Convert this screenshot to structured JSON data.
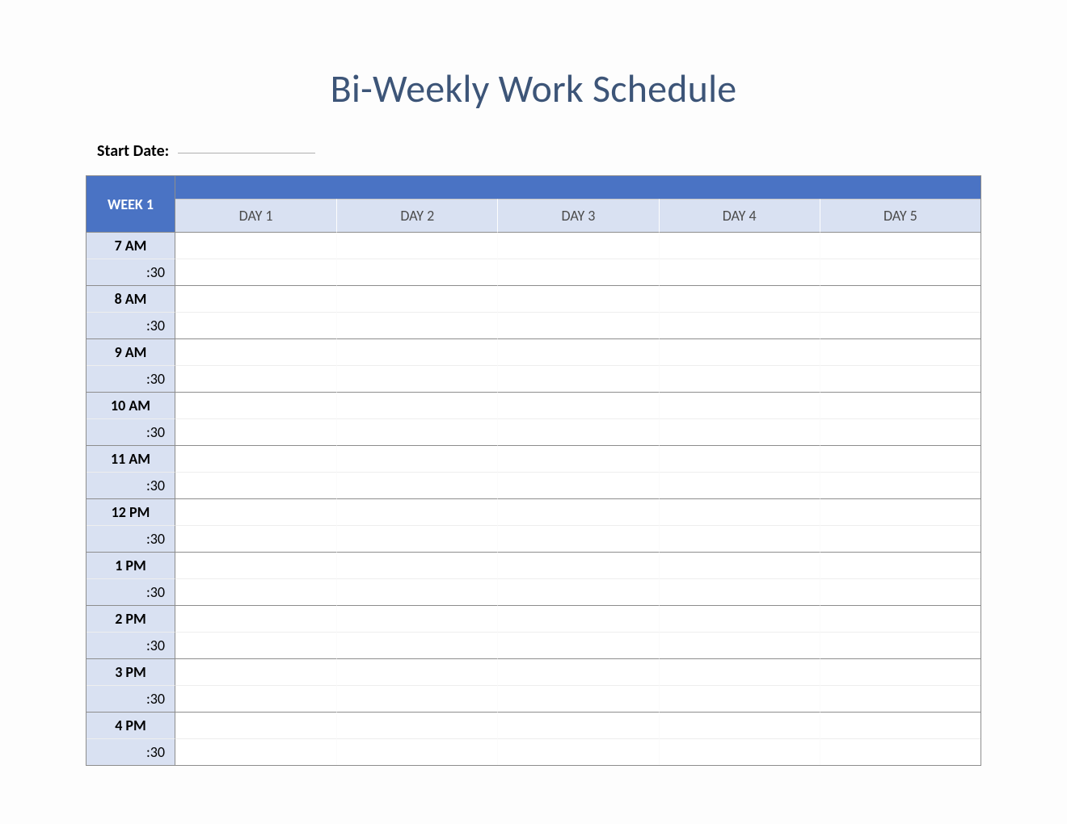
{
  "title": "Bi-Weekly Work Schedule",
  "start_date_label": "Start Date:",
  "start_date_value": "",
  "week_label": "WEEK 1",
  "days": [
    "DAY 1",
    "DAY 2",
    "DAY 3",
    "DAY 4",
    "DAY 5"
  ],
  "half_label": ":30",
  "hours": [
    "7 AM",
    "8 AM",
    "9 AM",
    "10 AM",
    "11 AM",
    "12 PM",
    "1 PM",
    "2 PM",
    "3 PM",
    "4 PM"
  ]
}
